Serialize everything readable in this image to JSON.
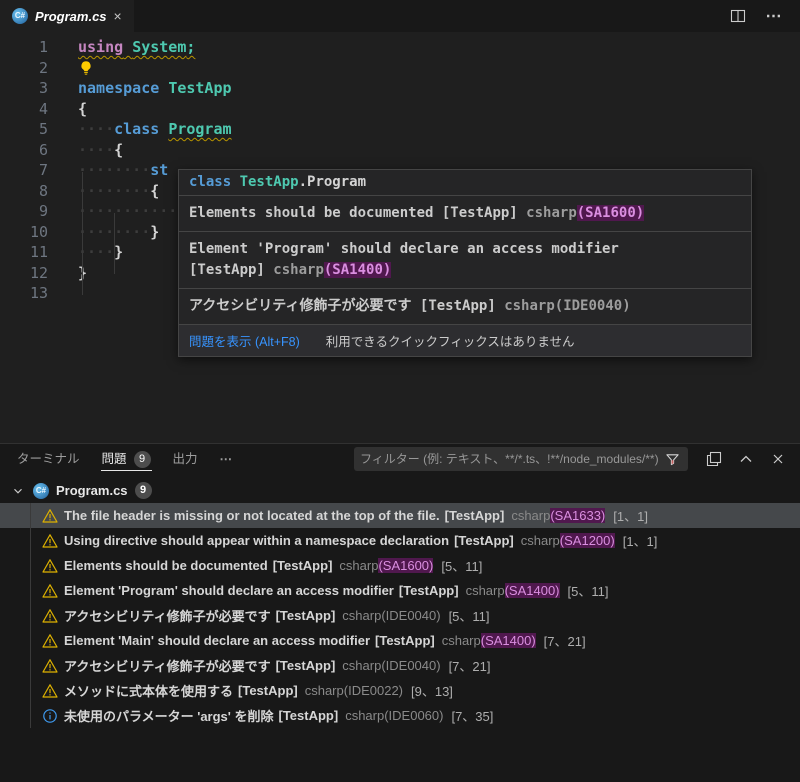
{
  "editor_tab": {
    "title": "Program.cs",
    "close_label": "×"
  },
  "editor_actions": {
    "more_label": "⋯"
  },
  "editor": {
    "lines": [
      {
        "num": "1",
        "tokens": [
          {
            "t": "using",
            "c": "kw-purple",
            "sq": true
          },
          {
            "t": " ",
            "c": "plain",
            "sq": true
          },
          {
            "t": "System",
            "c": "type",
            "sq": true
          },
          {
            "t": ";",
            "c": "type",
            "sq": true
          }
        ]
      },
      {
        "num": "2",
        "bulb": true,
        "tokens": []
      },
      {
        "num": "3",
        "tokens": [
          {
            "t": "namespace",
            "c": "kw-blue"
          },
          {
            "t": " ",
            "c": "plain"
          },
          {
            "t": "TestApp",
            "c": "type"
          }
        ]
      },
      {
        "num": "4",
        "tokens": [
          {
            "t": "{",
            "c": "plain"
          }
        ]
      },
      {
        "num": "5",
        "tokens": [
          {
            "t": "····",
            "c": "ws"
          },
          {
            "t": "class",
            "c": "kw-blue"
          },
          {
            "t": " ",
            "c": "plain"
          },
          {
            "t": "Program",
            "c": "type",
            "sq": true
          }
        ]
      },
      {
        "num": "6",
        "tokens": [
          {
            "t": "····",
            "c": "ws"
          },
          {
            "t": "{",
            "c": "plain"
          }
        ]
      },
      {
        "num": "7",
        "tokens": [
          {
            "t": "········",
            "c": "ws"
          },
          {
            "t": "st",
            "c": "kw-blue"
          }
        ]
      },
      {
        "num": "8",
        "tokens": [
          {
            "t": "········",
            "c": "ws"
          },
          {
            "t": "{",
            "c": "plain"
          }
        ]
      },
      {
        "num": "9",
        "tokens": [
          {
            "t": "············",
            "c": "ws"
          }
        ]
      },
      {
        "num": "10",
        "tokens": [
          {
            "t": "········",
            "c": "ws"
          },
          {
            "t": "}",
            "c": "plain"
          }
        ]
      },
      {
        "num": "11",
        "tokens": [
          {
            "t": "····",
            "c": "ws"
          },
          {
            "t": "}",
            "c": "plain"
          }
        ]
      },
      {
        "num": "12",
        "tokens": [
          {
            "t": "}",
            "c": "plain"
          }
        ]
      },
      {
        "num": "13",
        "tokens": []
      }
    ]
  },
  "hover": {
    "signature": [
      {
        "t": "class ",
        "c": "kw-blue"
      },
      {
        "t": "TestApp",
        "c": "type"
      },
      {
        "t": ".Program",
        "c": "plain"
      }
    ],
    "diagnostics": [
      {
        "message": "Elements should be documented",
        "scope": "[TestApp]",
        "source": "csharp",
        "code": "(SA1600)",
        "code_highlight": true,
        "wrap": false
      },
      {
        "message": "Element 'Program' should declare an access modifier",
        "scope": "[TestApp]",
        "source": "csharp",
        "code": "(SA1400)",
        "code_highlight": true,
        "wrap": true
      },
      {
        "message": "アクセシビリティ修飾子が必要です",
        "scope": "[TestApp]",
        "source": "csharp",
        "code": "(IDE0040)",
        "code_highlight": false,
        "wrap": false
      }
    ],
    "footer": {
      "link": "問題を表示 (Alt+F8)",
      "hint": "利用できるクイックフィックスはありません"
    }
  },
  "panel": {
    "tabs": [
      {
        "label": "ターミナル",
        "active": false,
        "badge": null
      },
      {
        "label": "問題",
        "active": true,
        "badge": "9"
      },
      {
        "label": "出力",
        "active": false,
        "badge": null
      }
    ],
    "more_label": "⋯",
    "filter_placeholder": "フィルター (例: テキスト、**/*.ts、!**/node_modules/**)",
    "file_group": {
      "name": "Program.cs",
      "badge": "9"
    },
    "problems": [
      {
        "severity": "warning",
        "message": "The file header is missing or not located at the top of the file.",
        "scope": "[TestApp]",
        "source": "csharp",
        "code": "(SA1633)",
        "code_highlight": true,
        "position": "[1、1]",
        "selected": true
      },
      {
        "severity": "warning",
        "message": "Using directive should appear within a namespace declaration",
        "scope": "[TestApp]",
        "source": "csharp",
        "code": "(SA1200)",
        "code_highlight": true,
        "position": "[1、1]",
        "selected": false
      },
      {
        "severity": "warning",
        "message": "Elements should be documented",
        "scope": "[TestApp]",
        "source": "csharp",
        "code": "(SA1600)",
        "code_highlight": true,
        "position": "[5、11]",
        "selected": false
      },
      {
        "severity": "warning",
        "message": "Element 'Program' should declare an access modifier",
        "scope": "[TestApp]",
        "source": "csharp",
        "code": "(SA1400)",
        "code_highlight": true,
        "position": "[5、11]",
        "selected": false
      },
      {
        "severity": "warning",
        "message": "アクセシビリティ修飾子が必要です",
        "scope": "[TestApp]",
        "source": "csharp",
        "code": "(IDE0040)",
        "code_highlight": false,
        "position": "[5、11]",
        "selected": false
      },
      {
        "severity": "warning",
        "message": "Element 'Main' should declare an access modifier",
        "scope": "[TestApp]",
        "source": "csharp",
        "code": "(SA1400)",
        "code_highlight": true,
        "position": "[7、21]",
        "selected": false
      },
      {
        "severity": "warning",
        "message": "アクセシビリティ修飾子が必要です",
        "scope": "[TestApp]",
        "source": "csharp",
        "code": "(IDE0040)",
        "code_highlight": false,
        "position": "[7、21]",
        "selected": false
      },
      {
        "severity": "warning",
        "message": "メソッドに式本体を使用する",
        "scope": "[TestApp]",
        "source": "csharp",
        "code": "(IDE0022)",
        "code_highlight": false,
        "position": "[9、13]",
        "selected": false
      },
      {
        "severity": "info",
        "message": "未使用のパラメーター 'args' を削除",
        "scope": "[TestApp]",
        "source": "csharp",
        "code": "(IDE0060)",
        "code_highlight": false,
        "position": "[7、35]",
        "selected": false
      }
    ]
  },
  "colors": {
    "warning": "#ddb100",
    "info": "#3f9bf0",
    "link": "#3794ff",
    "code_highlight_bg": "#50184e",
    "code_highlight_text": "#da8ee0",
    "keyword_blue": "#569cd6",
    "keyword_purple": "#c586c0",
    "type_teal": "#4ec9b0"
  }
}
